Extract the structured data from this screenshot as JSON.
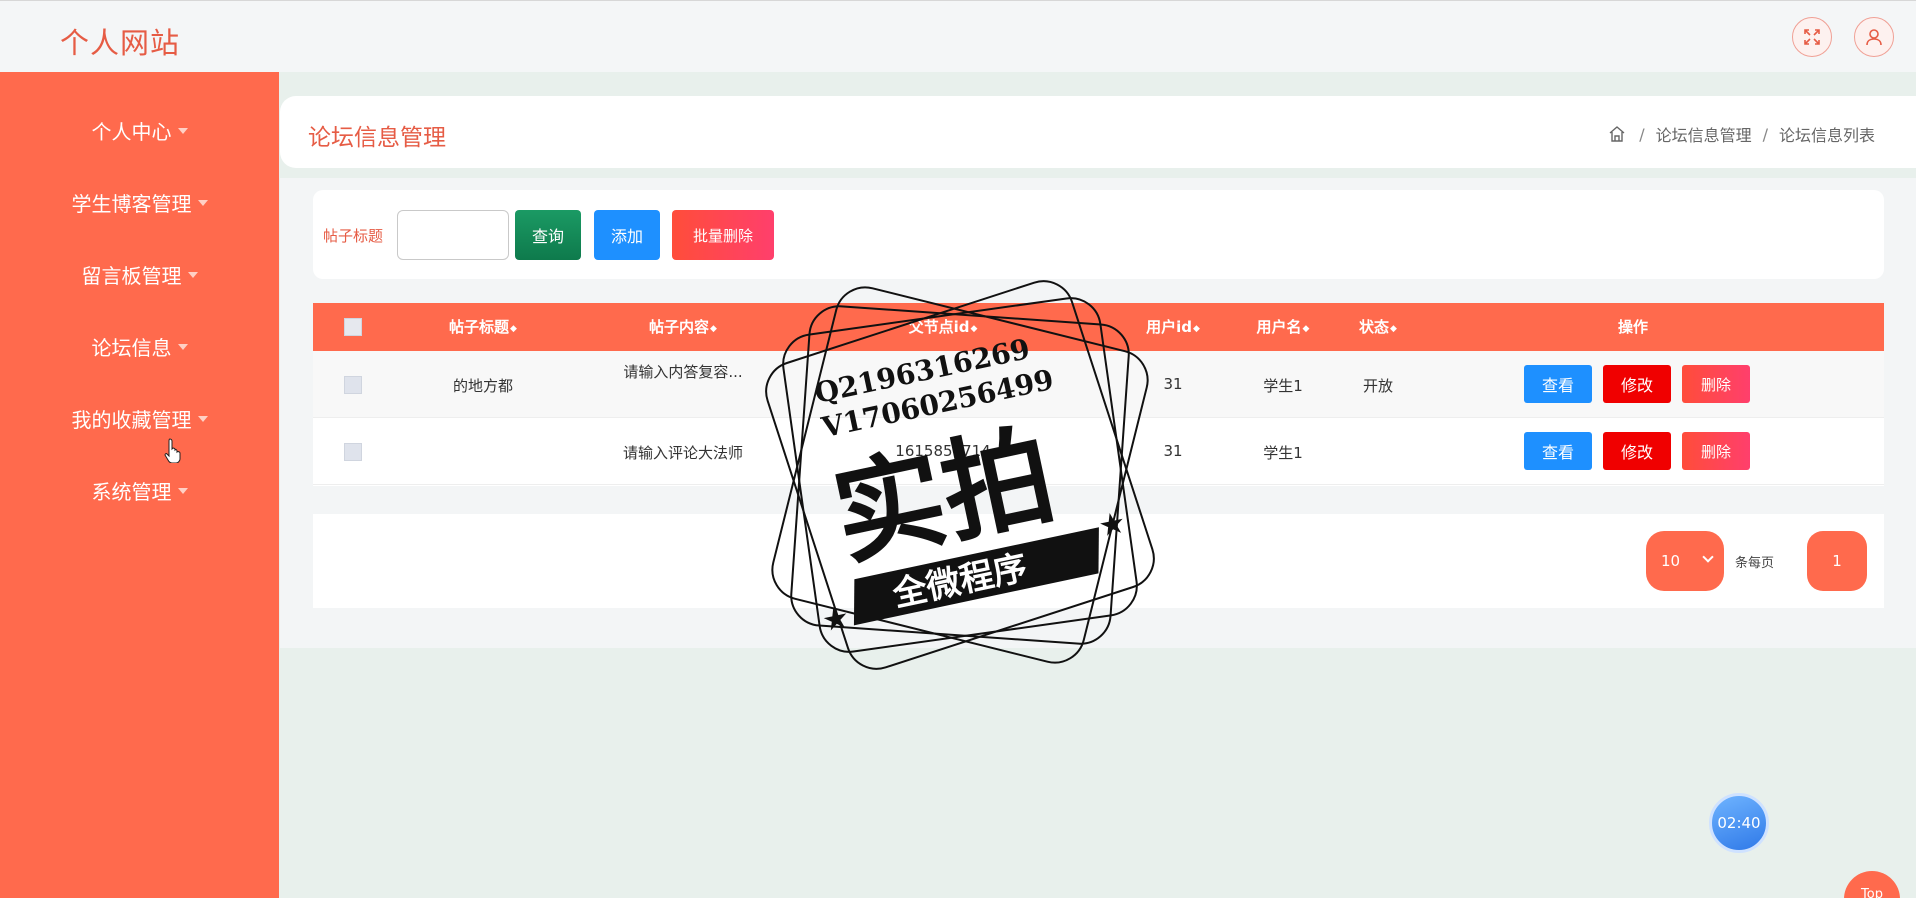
{
  "header": {
    "site_title": "个人网站",
    "fullscreen_icon": "expand-icon",
    "user_icon": "user-icon"
  },
  "sidebar": {
    "items": [
      {
        "label": "个人中心"
      },
      {
        "label": "学生博客管理"
      },
      {
        "label": "留言板管理"
      },
      {
        "label": "论坛信息"
      },
      {
        "label": "我的收藏管理"
      },
      {
        "label": "系统管理"
      }
    ]
  },
  "page": {
    "title": "论坛信息管理",
    "breadcrumb": [
      "论坛信息管理",
      "论坛信息列表"
    ]
  },
  "search": {
    "label": "帖子标题",
    "input_value": "",
    "query_label": "查询",
    "add_label": "添加",
    "batch_delete_label": "批量删除"
  },
  "table": {
    "columns": [
      "帖子标题",
      "帖子内容",
      "父节点id",
      "用户id",
      "用户名",
      "状态",
      "操作"
    ],
    "rows": [
      {
        "title": "的地方都",
        "content": "请输入内答复容...",
        "parent_id": "",
        "user_id": "31",
        "username": "学生1",
        "status": "开放"
      },
      {
        "title": "",
        "content": "请输入评论大法师",
        "parent_id": "1615859714",
        "user_id": "31",
        "username": "学生1",
        "status": ""
      }
    ],
    "actions": {
      "view": "查看",
      "edit": "修改",
      "delete": "删除"
    }
  },
  "pagination": {
    "page_size": "10",
    "per_page_label": "条每页",
    "current_page": "1"
  },
  "timer": "02:40",
  "top_label": "Top",
  "watermark": {
    "line1": "Q2196316269",
    "line2": "V17060256499",
    "main": "实拍",
    "banner": "全微程序"
  },
  "colors": {
    "accent": "#ff6a4d",
    "title": "#e65c45",
    "blue": "#1e90ff",
    "green": "#0e7a4c",
    "red": "#f00000"
  }
}
